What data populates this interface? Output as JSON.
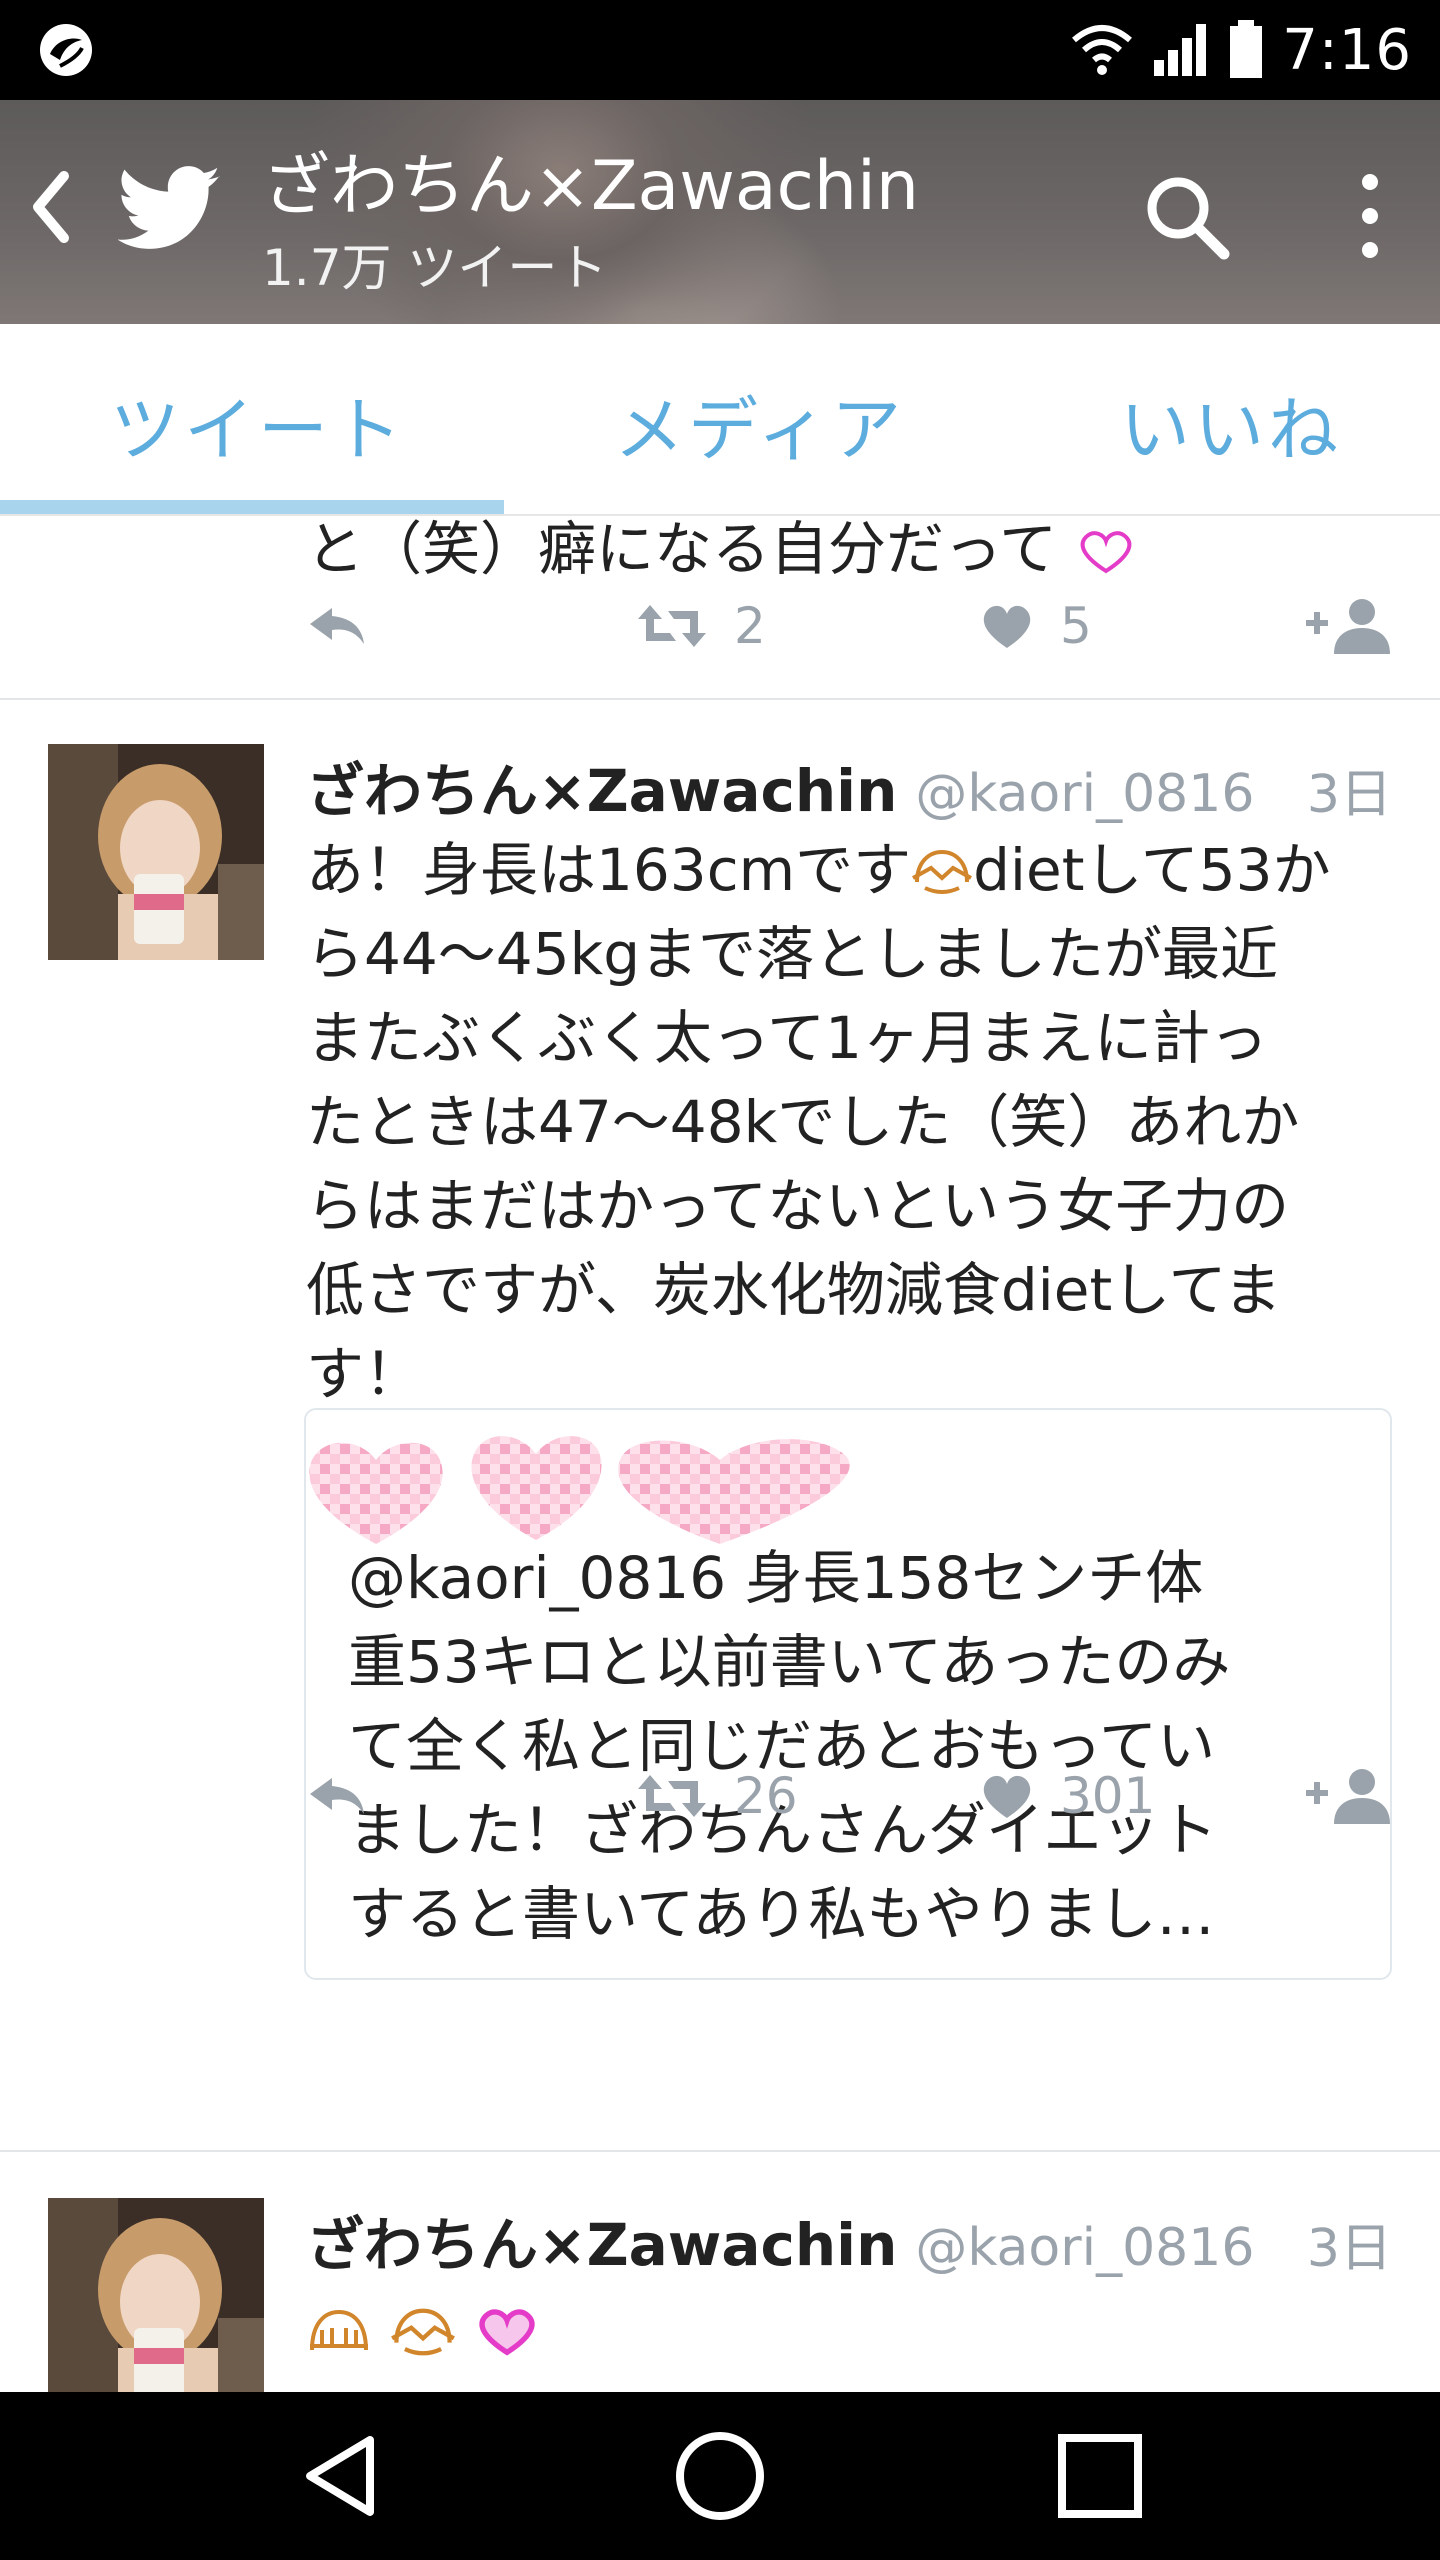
{
  "status_bar": {
    "time": "7:16"
  },
  "header": {
    "title": "ざわちん×Zawachin",
    "subtitle": "1.7万 ツイート"
  },
  "tabs": [
    {
      "label": "ツイート"
    },
    {
      "label": "メディア"
    },
    {
      "label": "いいね"
    }
  ],
  "previous_tweet": {
    "cut_text": "と（笑）癖になる自分だって",
    "retweets": "2",
    "likes": "5"
  },
  "tweets": [
    {
      "name": "ざわちん×Zawachin",
      "handle": "@kaori_0816",
      "time": "3日",
      "body_lines": [
        "あ！身長は163cmです",
        "diet",
        "して53か",
        "ら44〜45kgまで落としましたが最近",
        "またぶくぶく太って1ヶ月まえに計っ",
        "たときは47〜48kでした（笑）あれか",
        "らはまだはかってないという女子力の",
        "低さですが、炭水化物減食dietしてま",
        "す！"
      ],
      "quote": {
        "lines": [
          "@kaori_0816 身長158センチ体",
          "重53キロと以前書いてあったのみ",
          "て全く私と同じだあとおもってい",
          "ました！ざわちんさんダイエット",
          "すると書いてあり私もやりまし…"
        ]
      },
      "retweets": "26",
      "likes": "301"
    },
    {
      "name": "ざわちん×Zawachin",
      "handle": "@kaori_0816",
      "time": "3日"
    }
  ],
  "colors": {
    "accent": "#5cacde",
    "tab_indicator": "#a8d4ee",
    "muted": "#9aa3ab",
    "heart_pink": "#e43cc8"
  }
}
